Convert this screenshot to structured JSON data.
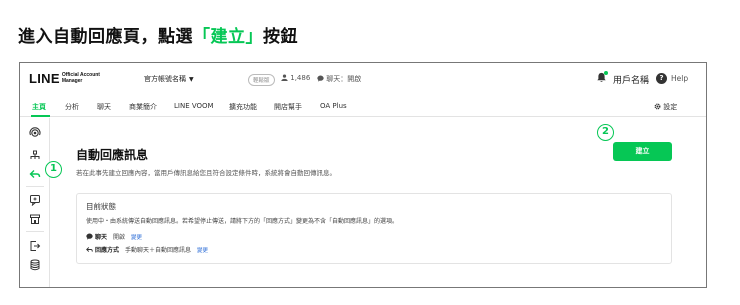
{
  "instruction": {
    "prefix": "進入自動回應頁，點選",
    "highlight": "「建立」",
    "suffix": "按鈕"
  },
  "header": {
    "logo_main": "LINE",
    "logo_sub_line1": "Official Account",
    "logo_sub_line2": "Manager",
    "account_name": "官方帳號名稱",
    "plan_badge": "輕鬆版",
    "friends_count": "1,486",
    "chat_status": "聊天：開啟",
    "username": "用戶名稱",
    "help_label": "Help"
  },
  "nav": {
    "items": [
      "主頁",
      "分析",
      "聊天",
      "商業簡介",
      "LINE VOOM",
      "擴充功能",
      "開店幫手",
      "OA Plus"
    ],
    "active_index": 0,
    "settings": "設定"
  },
  "markers": {
    "one": "1",
    "two": "2"
  },
  "main": {
    "title": "自動回應訊息",
    "description": "若在此事先建立回應內容，當用戶傳訊息給您且符合設定條件時，系統將會自動回傳訊息。",
    "create_button": "建立"
  },
  "status_card": {
    "title": "目前狀態",
    "description": "使用中・由系統傳送自動回應訊息。若希望停止傳送，請將下方的「回應方式」變更為不含「自動回應訊息」的選項。",
    "chat_label": "聊天",
    "chat_value": "開啟",
    "chat_change": "變更",
    "mode_label": "回應方式",
    "mode_value": "手動聊天＋自動回應訊息",
    "mode_change": "變更"
  },
  "colors": {
    "accent": "#06c755",
    "link": "#2a6bd6"
  },
  "icons": [
    "bell-icon",
    "help-icon",
    "gear-icon",
    "user-icon",
    "chat-icon",
    "antenna-icon",
    "hierarchy-icon",
    "reply-icon",
    "message-box-icon",
    "store-icon",
    "exit-icon",
    "database-icon"
  ]
}
